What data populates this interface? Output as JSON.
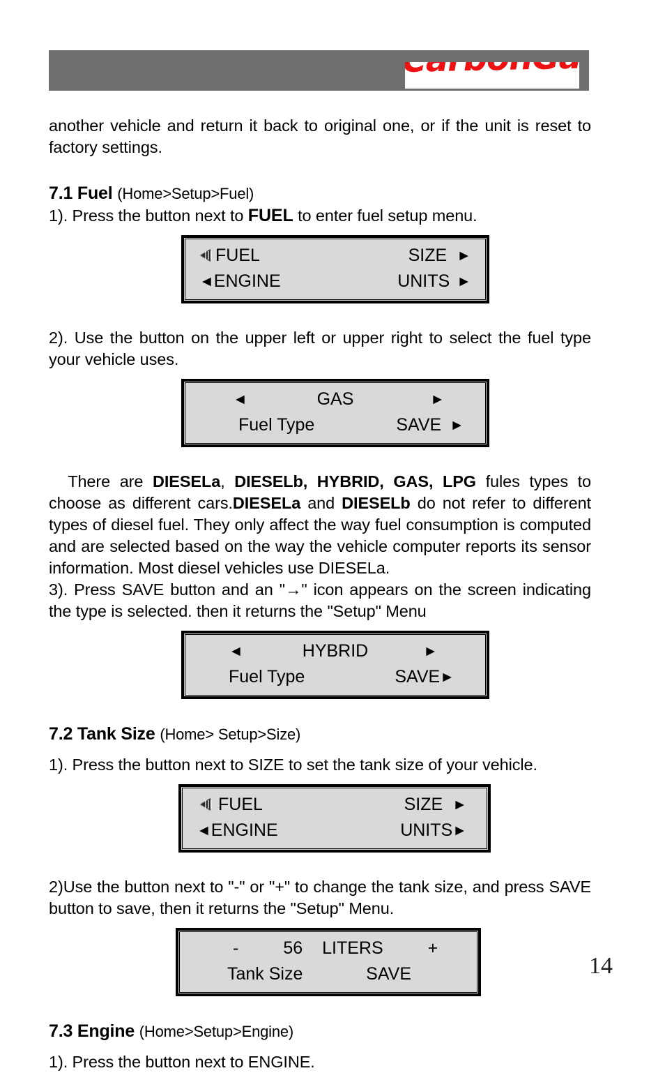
{
  "header": {
    "logo_text": "CarbonGauge",
    "logo_color": "#ee1111",
    "bar_color": "#6e6e6e"
  },
  "document": {
    "intro_paragraph": "another vehicle and return it back to original one, or if the unit is reset to factory settings.",
    "sections": [
      {
        "number": "7.1 Fuel",
        "path": "(Home>Setup>Fuel)",
        "step1_pre": "1). Press the button next to ",
        "step1_bold": "FUEL",
        "step1_post": " to enter fuel setup menu.",
        "step2": "2). Use the button on the upper left or upper right to select the fuel type your vehicle uses.",
        "types_p1": "There are ",
        "types_b1": "DIESELa",
        "types_c1": ", ",
        "types_b2": "DIESELb, HYBRID, GAS, LPG",
        "types_p2": " fules types to choose as different cars.",
        "types_b3": "DIESELa",
        "types_p3": " and ",
        "types_b4": "DIESELb",
        "types_p4": " do not refer to different types of diesel fuel. They only affect the way fuel consumption is computed and are selected based on the way the vehicle computer reports its sensor information. Most diesel vehicles use DIESELa.",
        "step3": "3). Press SAVE button and an \"→\" icon appears on the screen indicating the type is selected. then it returns the \"Setup\" Menu"
      },
      {
        "number": "7.2 Tank Size",
        "path": "(Home> Setup>Size)",
        "step1": "1). Press the button next to SIZE to set the tank size of your vehicle.",
        "step2": "2)Use the button next to \"-\" or \"+\" to change the tank size, and press SAVE button to save, then it returns the \"Setup\" Menu."
      },
      {
        "number": "7.3 Engine",
        "path": "(Home>Setup>Engine)",
        "step1": "1). Press the button next to ENGINE."
      }
    ],
    "page_number": "14"
  },
  "lcd_panels": [
    {
      "id": "setup-menu-1",
      "row1_left_icon": "selection-cursor-icon",
      "row1_left": "FUEL",
      "row1_right": "SIZE",
      "row1_right_arrow": "►",
      "row2_left_arrow": "◄",
      "row2_left": "ENGINE",
      "row2_right": "UNITS",
      "row2_right_arrow": "►"
    },
    {
      "id": "fuel-type-gas",
      "row1_left_arrow": "◄",
      "row1_center": "GAS",
      "row1_right_arrow": "►",
      "row2_left": "Fuel Type",
      "row2_right": "SAVE",
      "row2_right_arrow": "►"
    },
    {
      "id": "fuel-type-hybrid",
      "row1_left_arrow": "◄",
      "row1_center": "HYBRID",
      "row1_right_arrow": "►",
      "row2_left": "Fuel Type",
      "row2_right": "SAVE",
      "row2_right_arrow": "►"
    },
    {
      "id": "setup-menu-2",
      "row1_left_icon": "selection-cursor-icon",
      "row1_left": "FUEL",
      "row1_right": "SIZE",
      "row1_right_arrow": "►",
      "row2_left_arrow": "◄",
      "row2_left": "ENGINE",
      "row2_right": "UNITS",
      "row2_right_arrow": "►"
    },
    {
      "id": "tank-size",
      "row1_minus": "-",
      "row1_value": "56",
      "row1_unit": "LITERS",
      "row1_plus": "+",
      "row2_left": "Tank Size",
      "row2_right": "SAVE"
    }
  ]
}
